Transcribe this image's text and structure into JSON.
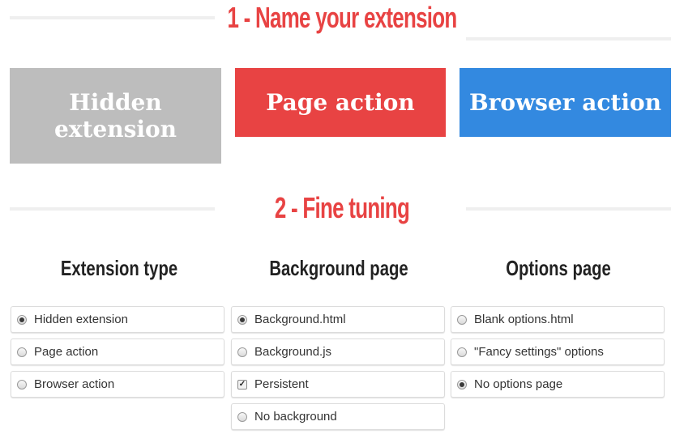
{
  "step1": {
    "title": "1 - Name your extension"
  },
  "step2": {
    "title": "2 - Fine tuning"
  },
  "extension_choices": [
    {
      "label": "Hidden extension",
      "color": "#bdbdbd"
    },
    {
      "label": "Page action",
      "color": "#e84343"
    },
    {
      "label": "Browser action",
      "color": "#3389e0"
    }
  ],
  "columns": {
    "extension_type": {
      "title": "Extension type",
      "options": [
        {
          "label": "Hidden extension",
          "selected": true
        },
        {
          "label": "Page action",
          "selected": false
        },
        {
          "label": "Browser action",
          "selected": false
        }
      ]
    },
    "background_page": {
      "title": "Background page",
      "options": [
        {
          "label": "Background.html",
          "selected": true,
          "kind": "radio"
        },
        {
          "label": "Background.js",
          "selected": false,
          "kind": "radio"
        },
        {
          "label": "Persistent",
          "selected": true,
          "kind": "checkbox"
        },
        {
          "label": "No background",
          "selected": false,
          "kind": "radio"
        }
      ]
    },
    "options_page": {
      "title": "Options page",
      "options": [
        {
          "label": "Blank options.html",
          "selected": false
        },
        {
          "label": "\"Fancy settings\" options",
          "selected": false
        },
        {
          "label": "No options page",
          "selected": true
        }
      ]
    }
  }
}
